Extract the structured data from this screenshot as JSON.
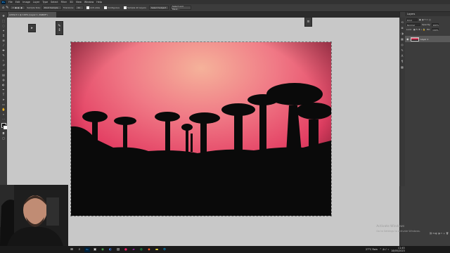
{
  "menubar": {
    "app_icon": "Ps",
    "items": [
      "File",
      "Edit",
      "Image",
      "Layer",
      "Type",
      "Select",
      "Filter",
      "3D",
      "View",
      "Window",
      "Help"
    ]
  },
  "options_bar": {
    "home_icon": "home-icon",
    "tool_icon": "brush-icon",
    "sample_size_label": "Sample Size:",
    "sample_size_value": "Point Sample",
    "tolerance_label": "Tolerance:",
    "tolerance_value": "32",
    "anti_alias_label": "Anti-alias",
    "contiguous_label": "Contiguous",
    "sample_all_layers_label": "Sample All Layers",
    "select_subject_label": "Select Subject",
    "select_and_mask_label": "Select and Mask..."
  },
  "document": {
    "tab_title": "Artifact 1 @ 100% (Layer 1, RGB/8*)"
  },
  "layers_panel": {
    "title": "Layers",
    "kind_label": "Kind",
    "blend_mode": "Normal",
    "opacity_label": "Opacity:",
    "opacity_value": "100%",
    "lock_label": "Lock:",
    "fill_label": "Fill:",
    "fill_value": "100%",
    "layer_name": "Layer 1"
  },
  "watermark": {
    "line1": "Activate Windows",
    "line2": "Go to Settings to activate Windows."
  },
  "taskbar": {
    "search_icon": "search-icon",
    "weather": "27°C  Rain",
    "clock_time": "11:45",
    "clock_date": "18/05/2023"
  },
  "colors": {
    "sky_top": "#f07a86",
    "sky_mid": "#e33f63",
    "sky_bottom": "#b0173f",
    "silhouette": "#0a0a0a",
    "photoshop_blue": "#31a8ff"
  }
}
